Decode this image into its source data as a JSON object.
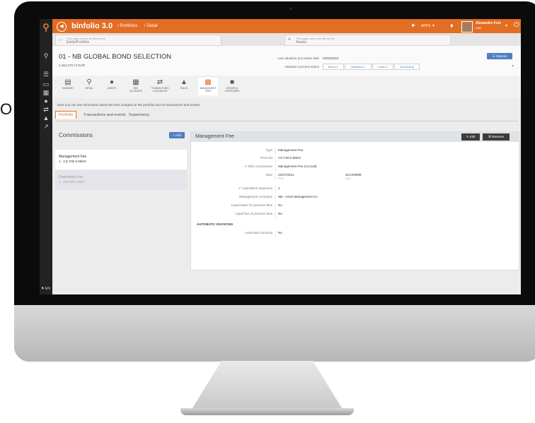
{
  "background_letter": "O",
  "app": {
    "brand": "binfolio 3.0",
    "crumb_portfolios": "/ Portfolios",
    "crumb_detail": "/ Detail",
    "apps_label": "APPS",
    "user_name": "Alexandre Folo",
    "user_role": "AMF"
  },
  "filters": [
    {
      "line1": "This page cannot be filtered by",
      "line2": "Entity/Portfolio"
    },
    {
      "line1": "This page cannot be filtered by",
      "line2": "Assets"
    }
  ],
  "header": {
    "title": "01 - NB GLOBAL BOND SELECTION",
    "subtitle": "4,484,270.74 EUR",
    "last_valuation_label": "Last valuation procedure date",
    "last_valuation_value": "02/04/2015",
    "valuation_status_label": "Valuation process status",
    "statuses": [
      "Event",
      "Valuation",
      "Limits",
      "Accounting"
    ],
    "options_label": "Options"
  },
  "nav_tabs": [
    {
      "l1": "SUMMARY",
      "l2": ""
    },
    {
      "l1": "DETAIL",
      "l2": ""
    },
    {
      "l1": "ASSETS",
      "l2": ""
    },
    {
      "l1": "DEC",
      "l2": "ACCOUNTS"
    },
    {
      "l1": "TRANSACTIONS",
      "l2": "& VALUATION"
    },
    {
      "l1": "RULES",
      "l2": ""
    },
    {
      "l1": "MANAGEMENT",
      "l2": "FEES"
    },
    {
      "l1": "GROUPS &",
      "l2": "CATEGORIES"
    }
  ],
  "info_text": "Here you can see information about the fees charged on the portfolio and on transactions and events.",
  "sub_tabs": [
    "Portfolio",
    "Transactions and events",
    "Supervisory"
  ],
  "commissions": {
    "title": "Commissions",
    "add_label": "Add",
    "items": [
      {
        "name": "Management Fee",
        "value": "1 - CG FIM 0.950%"
      },
      {
        "name": "Depositary Fee",
        "value": "1 - CD FIM 1.20%"
      }
    ]
  },
  "detail": {
    "title": "Management Fee",
    "edit_label": "Edit",
    "remove_label": "Remove",
    "type_label": "Type",
    "type_value": "Management Fee",
    "price_list_label": "Price list",
    "price_list_value": "CG FIM 0.950%",
    "dec_commission_label": "DEC commission",
    "dec_commission_value": "Management Fee (Accrual)",
    "date_label": "Date",
    "date_from": "22/07/2013",
    "date_from_caption": "From",
    "date_to": "31/12/9999",
    "date_to_caption": "Until",
    "calc_seq_label": "Calculation sequence",
    "calc_seq_value": "1",
    "mgmt_company_label": "Management Company",
    "mgmt_company_value": "NB - Asset Management Co",
    "liquid_basis_label": "Liquid basis for previous fees",
    "liquid_basis_value": "No",
    "liquid_fee_label": "Liquid fee of previous fees",
    "liquid_fee_value": "No",
    "auto_invoicing_section": "AUTOMATIC INVOICING",
    "auto_invoicing_label": "Automatic Invoicing",
    "auto_invoicing_value": "No"
  },
  "colors": {
    "accent": "#e36d22",
    "primary_button": "#4f7fc2",
    "sidebar": "#222222"
  }
}
